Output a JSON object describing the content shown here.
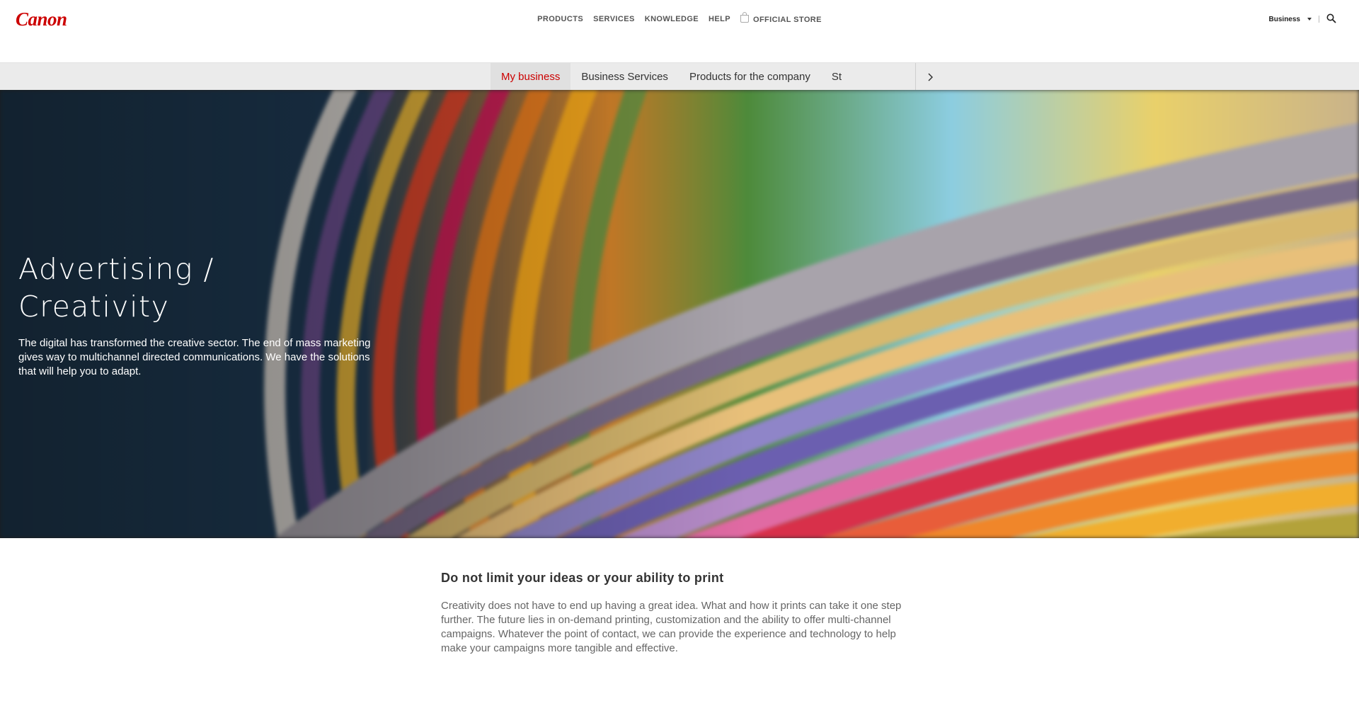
{
  "header": {
    "logo": "Canon",
    "nav": [
      "PRODUCTS",
      "SERVICES",
      "KNOWLEDGE",
      "HELP",
      "OFFICIAL STORE"
    ],
    "business_select": "Business"
  },
  "subnav": {
    "items": [
      "My business",
      "Business Services",
      "Products for the company",
      "St"
    ],
    "active": "My business"
  },
  "hero": {
    "title_line1": "Advertising /",
    "title_line2": "Creativity",
    "text": "The digital has transformed the creative sector. The end of mass marketing gives way to multichannel directed communications. We have the solutions that will help you to adapt."
  },
  "content": {
    "heading": "Do not limit your ideas or your ability to print",
    "body": "Creativity does not have to end up having a great idea. What and how it prints can take it one step further. The future lies in on-demand printing, customization and the ability to offer multi-channel campaigns. Whatever the point of contact, we can provide the experience and technology to help make your campaigns more tangible and effective."
  },
  "colors": {
    "brand_red": "#cc0000",
    "active_tab": "#cc0000",
    "subnav_bg": "#ebebeb"
  }
}
